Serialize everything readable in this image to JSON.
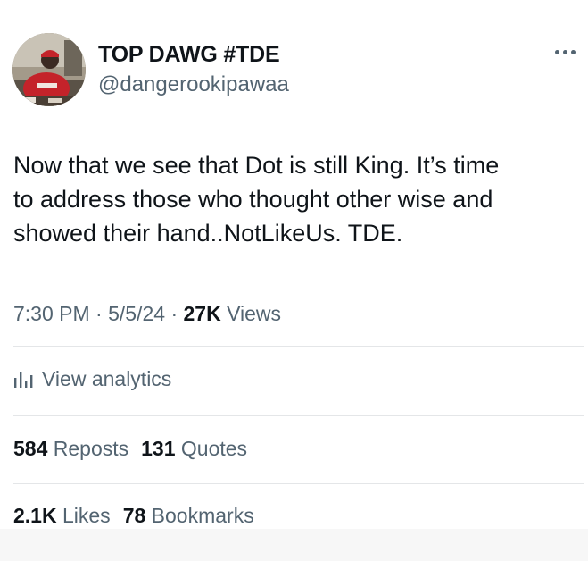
{
  "author": {
    "display_name": "TOP DAWG #TDE",
    "handle": "@dangerookipawaa",
    "avatar_icon": "profile-photo"
  },
  "more_icon": "ellipsis-icon",
  "tweet": {
    "line1": "Now that we see that Dot is still King. It’s time",
    "line2": "to address those who thought other wise and",
    "line3": "showed their hand..NotLikeUs. TDE."
  },
  "meta": {
    "time": "7:30 PM",
    "sep1": " · ",
    "date": "5/5/24",
    "sep2": " · ",
    "views_count": "27K",
    "views_label": " Views"
  },
  "analytics": {
    "label": "View analytics",
    "icon": "bar-chart-icon"
  },
  "stats": {
    "reposts_count": "584",
    "reposts_label": " Reposts",
    "quotes_count": "131",
    "quotes_label": " Quotes",
    "likes_count": "2.1K",
    "likes_label": " Likes",
    "bookmarks_count": "78",
    "bookmarks_label": " Bookmarks"
  },
  "colors": {
    "primary_text": "#0f1419",
    "secondary_text": "#536471",
    "divider": "#e4e6e8"
  }
}
